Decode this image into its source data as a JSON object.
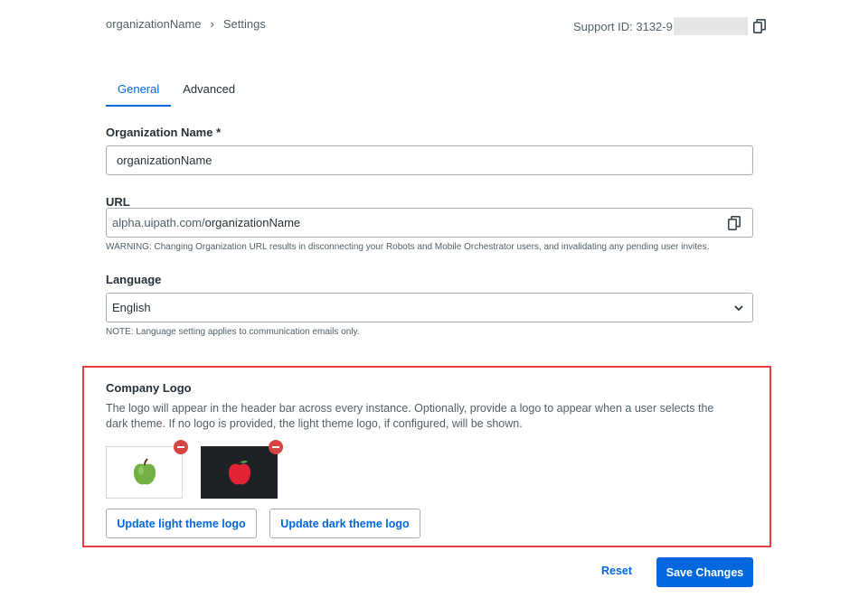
{
  "breadcrumb": {
    "org": "organizationName",
    "separator": "›",
    "page": "Settings"
  },
  "support": {
    "label": "Support ID: 3132-9"
  },
  "tabs": [
    {
      "label": "General",
      "active": true
    },
    {
      "label": "Advanced",
      "active": false
    }
  ],
  "form": {
    "org_name_label": "Organization Name *",
    "org_name_value": "organizationName",
    "url_label": "URL",
    "url_prefix": "alpha.uipath.com/",
    "url_value": "organizationName",
    "url_warning": "WARNING: Changing Organization URL results in disconnecting your Robots and Mobile Orchestrator users, and invalidating any pending user invites.",
    "language_label": "Language",
    "language_value": "English",
    "language_note": "NOTE: Language setting applies to communication emails only."
  },
  "company_logo": {
    "title": "Company Logo",
    "description": "The logo will appear in the header bar across every instance. Optionally, provide a logo to appear when a user selects the dark theme. If no logo is provided, the light theme logo, if configured, will be shown.",
    "update_light_label": "Update light theme logo",
    "update_dark_label": "Update dark theme logo"
  },
  "actions": {
    "reset_label": "Reset",
    "save_label": "Save Changes"
  },
  "colors": {
    "accent": "#0067df",
    "highlight_border": "#e53e44",
    "remove": "#d64541"
  },
  "icons": [
    "chevron-right-icon",
    "copy-icon",
    "chevron-down-icon",
    "remove-icon",
    "green-apple-icon",
    "red-apple-icon"
  ]
}
